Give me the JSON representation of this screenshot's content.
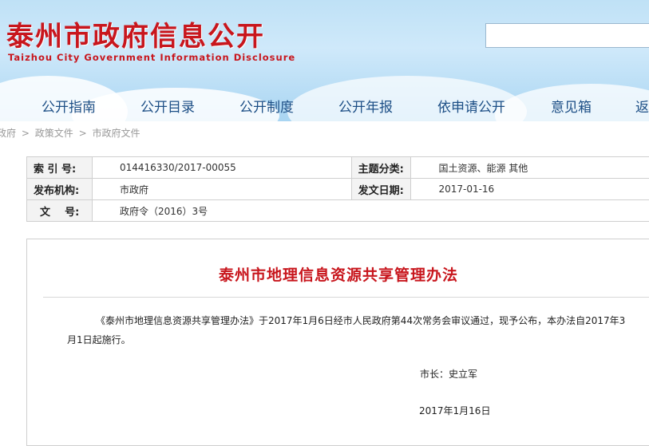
{
  "header": {
    "title": "泰州市政府信息公开",
    "subtitle": "Taizhou City Government Information Disclosure"
  },
  "search": {
    "placeholder": ""
  },
  "nav": {
    "items": [
      "公开指南",
      "公开目录",
      "公开制度",
      "公开年报",
      "依申请公开",
      "意见箱",
      "返"
    ]
  },
  "breadcrumb": {
    "items": [
      "政府",
      "政策文件",
      "市政府文件"
    ],
    "separator": ">"
  },
  "meta": {
    "index_label": "索 引 号:",
    "index_value": "014416330/2017-00055",
    "topic_label": "主题分类:",
    "topic_value": "国土资源、能源 其他",
    "publisher_label": "发布机构:",
    "publisher_value": "市政府",
    "date_label": "发文日期:",
    "date_value": "2017-01-16",
    "docno_label": "文    号:",
    "docno_value": "政府令（2016）3号"
  },
  "document": {
    "title": "泰州市地理信息资源共享管理办法",
    "body": "《泰州市地理信息资源共享管理办法》于2017年1月6日经市人民政府第44次常务会审议通过，现予公布，本办法自2017年3月1日起施行。",
    "signature": "市长：史立军",
    "date": "2017年1月16日"
  },
  "colors": {
    "brand_red": "#c8161d",
    "nav_blue": "#1d4f86"
  }
}
